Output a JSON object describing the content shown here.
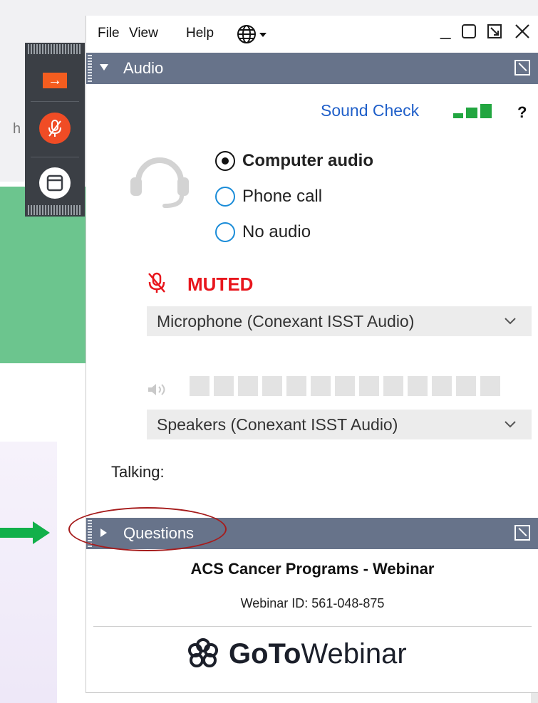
{
  "background": {
    "stub_text": "h"
  },
  "control_panel": {
    "arrow": "→"
  },
  "menu": {
    "file": "File",
    "view": "View",
    "help": "Help"
  },
  "window_controls": {
    "minimize": "_",
    "maximize": "▢",
    "popout": "⧉",
    "close": "✕"
  },
  "audio": {
    "section_title": "Audio",
    "sound_check": "Sound Check",
    "help": "?",
    "options": [
      {
        "label": "Computer audio",
        "selected": true
      },
      {
        "label": "Phone call",
        "selected": false
      },
      {
        "label": "No audio",
        "selected": false
      }
    ],
    "muted_label": "MUTED",
    "microphone": "Microphone (Conexant ISST Audio)",
    "speakers": "Speakers (Conexant ISST Audio)",
    "talking": "Talking:"
  },
  "questions": {
    "section_title": "Questions"
  },
  "footer": {
    "webinar_name": "ACS Cancer Programs - Webinar",
    "webinar_id": "Webinar ID: 561-048-875",
    "brand_goto": "GoTo",
    "brand_webinar": "Webinar"
  },
  "colors": {
    "accent_orange": "#f45d1f",
    "muted_red": "#e8161d",
    "link_blue": "#1f5fc9",
    "header_bar": "#67738a",
    "signal_green": "#22a640"
  }
}
